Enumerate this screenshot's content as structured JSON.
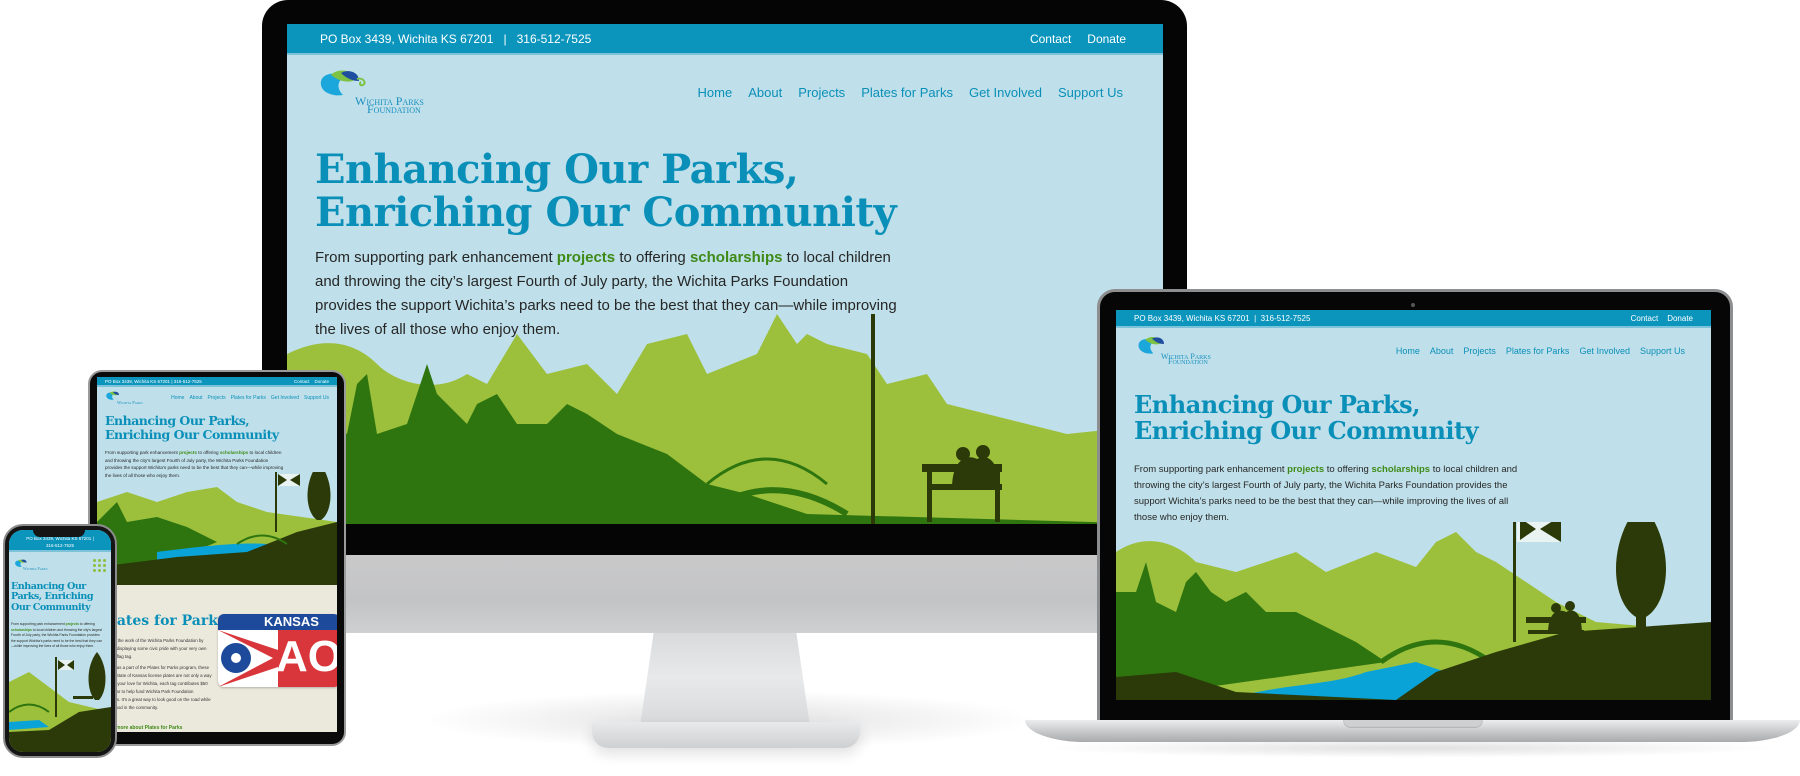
{
  "site": {
    "topbar": {
      "address": "PO Box 3439, Wichita KS 67201",
      "separator": "|",
      "phone": "316-512-7525",
      "links": [
        "Contact",
        "Donate"
      ]
    },
    "logo": {
      "line1": "Wichita Parks",
      "line2": "Foundation"
    },
    "nav": [
      "Home",
      "About",
      "Projects",
      "Plates for Parks",
      "Get Involved",
      "Support Us"
    ],
    "hero": {
      "title_line1": "Enhancing Our Parks,",
      "title_line2": "Enriching Our Community",
      "phone_title_line1": "Enhancing Our",
      "phone_title_line2": "Parks, Enriching",
      "phone_title_line3": "Our Community",
      "body_part1": "From supporting park enhancement ",
      "link1": "projects",
      "body_part2": " to offering ",
      "link2": "scholarships",
      "body_part3": " to local children and throwing the city’s largest Fourth of July party, the Wichita Parks Foundation provides the support Wichita’s parks need to be the best that they can—while improving the lives of all those who enjoy them."
    },
    "plates_section": {
      "title": "Plates for Parks",
      "paragraph1": "Support the work of the Wichita Parks Foundation by proudly displaying some civic pride with your very own Wichita flag tag.",
      "paragraph2": "Offered as a part of the Plates for Parks program, these special State of Kansas license plates are not only a way to show your love for Wichita, each tag contributes $50 each year to help fund Wichita Park Foundation initiatives. It’s a great way to look good on the road while doing good in the community.",
      "link": "Learn more about Plates for Parks",
      "plate_state": "KANSAS",
      "plate_number": "AO"
    }
  },
  "colors": {
    "topbar": "#0b95bd",
    "page_bg": "#bfe0ea",
    "heading": "#0a8fb8",
    "link_green": "#3f8a16",
    "dark_green": "#2b3a08",
    "mid_green": "#2e7510",
    "light_green": "#9dc03c",
    "water": "#0aa3d8"
  }
}
